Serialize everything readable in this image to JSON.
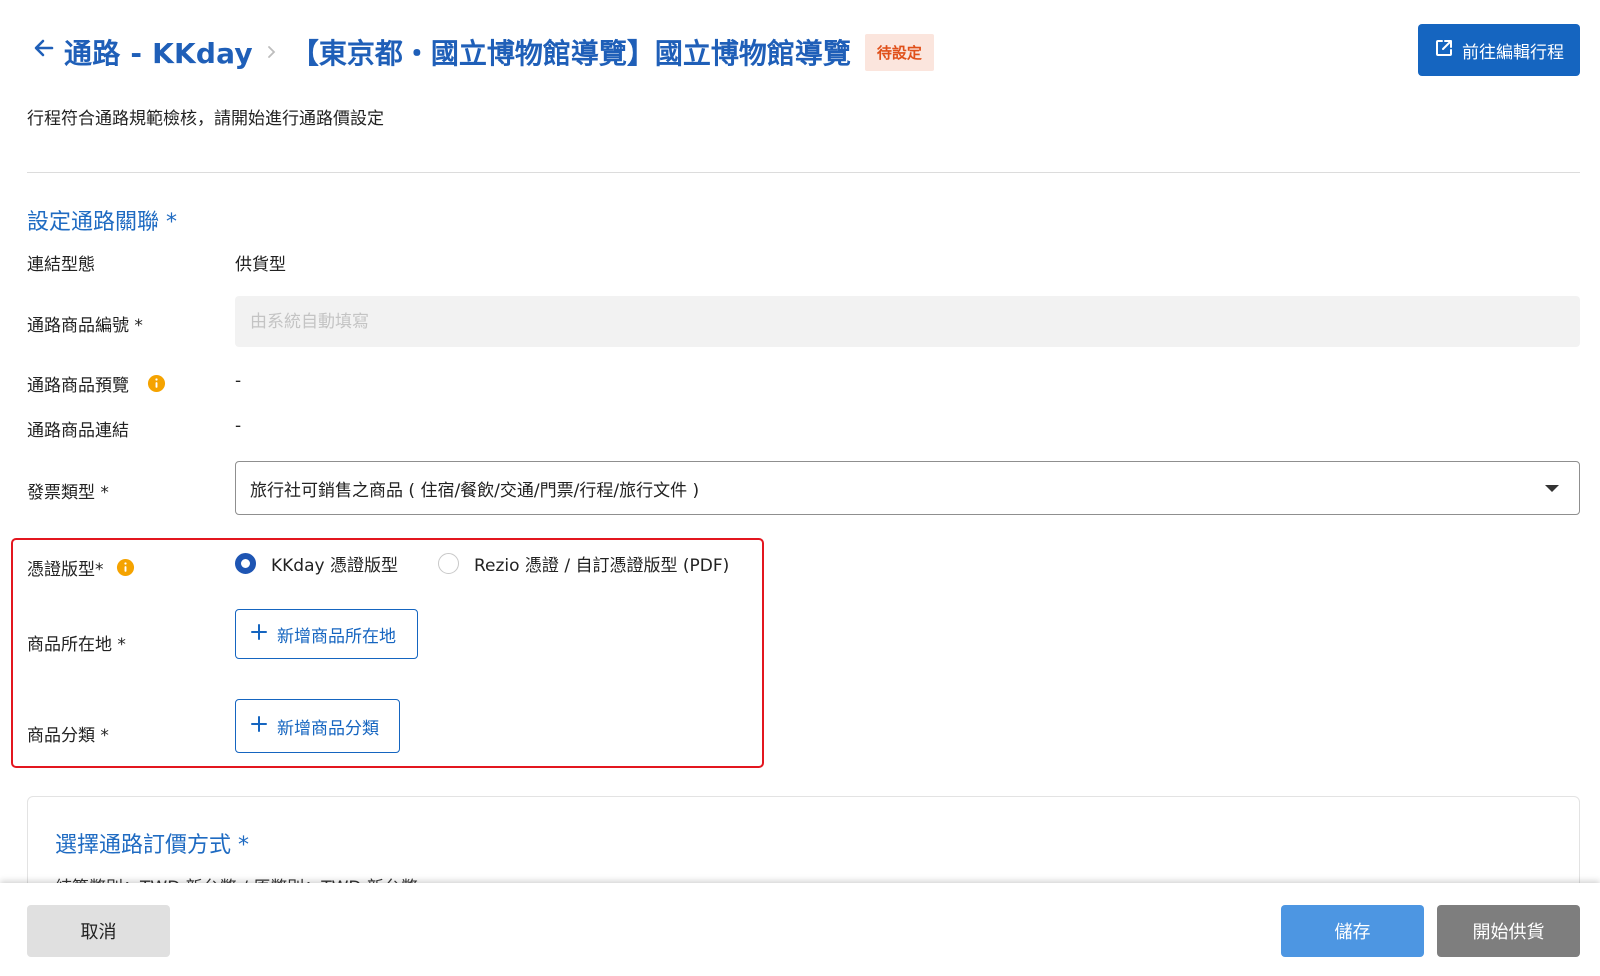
{
  "header": {
    "channel_title": "通路 - KKday",
    "product_title": "【東京都・國立博物館導覽】國立博物館導覽",
    "status_badge": "待設定",
    "edit_button_label": "前往編輯行程"
  },
  "subtitle": "行程符合通路規範檢核，請開始進行通路價設定",
  "section1": {
    "title": "設定通路關聯 *",
    "link_type_label": "連結型態",
    "link_type_value": "供貨型",
    "product_code_label": "通路商品編號 *",
    "product_code_placeholder": "由系統自動填寫",
    "preview_label": "通路商品預覽",
    "preview_value": "-",
    "link_label": "通路商品連結",
    "link_value": "-",
    "invoice_label": "發票類型 *",
    "invoice_value": "旅行社可銷售之商品 ( 住宿/餐飲/交通/門票/行程/旅行文件 )",
    "voucher_label": "憑證版型*",
    "voucher_options": [
      {
        "label": "KKday 憑證版型",
        "checked": true
      },
      {
        "label": "Rezio 憑證 / 自訂憑證版型 (PDF)",
        "checked": false
      }
    ],
    "location_label": "商品所在地 *",
    "add_location_label": "新增商品所在地",
    "category_label": "商品分類 *",
    "add_category_label": "新增商品分類"
  },
  "section2": {
    "title": "選擇通路訂價方式 *",
    "currency_text": "結算幣別：TWD 新台幣 / 原幣別：TWD 新台幣"
  },
  "footer": {
    "cancel_label": "取消",
    "save_label": "儲存",
    "supply_label": "開始供貨"
  },
  "colors": {
    "primary": "#1565c0",
    "title_blue": "#1f5fb8",
    "badge_bg": "#fbe5dd",
    "badge_text": "#e0501a",
    "highlight_red": "#e3161f",
    "info_orange": "#f5a300"
  },
  "icons": {
    "back": "arrow-left-icon",
    "separator": "chevron-right-icon",
    "edit": "external-link-icon",
    "info": "info-icon",
    "caret": "caret-down-icon",
    "add": "plus-icon"
  }
}
